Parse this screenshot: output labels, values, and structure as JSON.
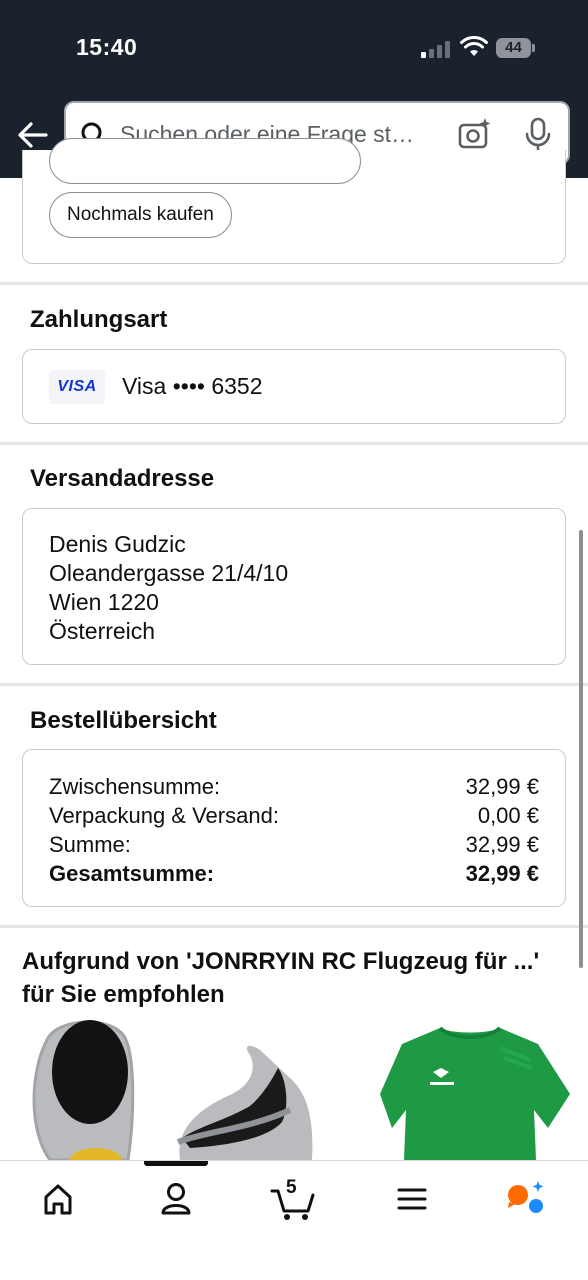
{
  "status_bar": {
    "time": "15:40",
    "battery": "44"
  },
  "search": {
    "placeholder": "Suchen oder eine Frage st…"
  },
  "order_actions": {
    "buy_again_label": "Nochmals kaufen"
  },
  "payment": {
    "title": "Zahlungsart",
    "card_brand": "VISA",
    "card_text": "Visa •••• 6352"
  },
  "shipping": {
    "title": "Versandadresse",
    "name": "Denis Gudzic",
    "street": "Oleandergasse 21/4/10",
    "city": "Wien 1220",
    "country": "Österreich"
  },
  "summary": {
    "title": "Bestellübersicht",
    "rows": [
      {
        "label": "Zwischensumme:",
        "value": "32,99 €"
      },
      {
        "label": "Verpackung & Versand:",
        "value": "0,00 €"
      },
      {
        "label": "Summe:",
        "value": "32,99 €"
      },
      {
        "label": "Gesamtsumme:",
        "value": "32,99 €"
      }
    ]
  },
  "recommendations": {
    "title": "Aufgrund von 'JONRRYIN RC Flugzeug für ...' für Sie empfohlen"
  },
  "bottom_nav": {
    "cart_count": "5"
  },
  "colors": {
    "header_bg": "#1a222e",
    "visa_blue": "#1434cb",
    "shirt_green": "#1e9a45",
    "ai_orange": "#ff6a00",
    "ai_blue": "#1a8cff"
  }
}
